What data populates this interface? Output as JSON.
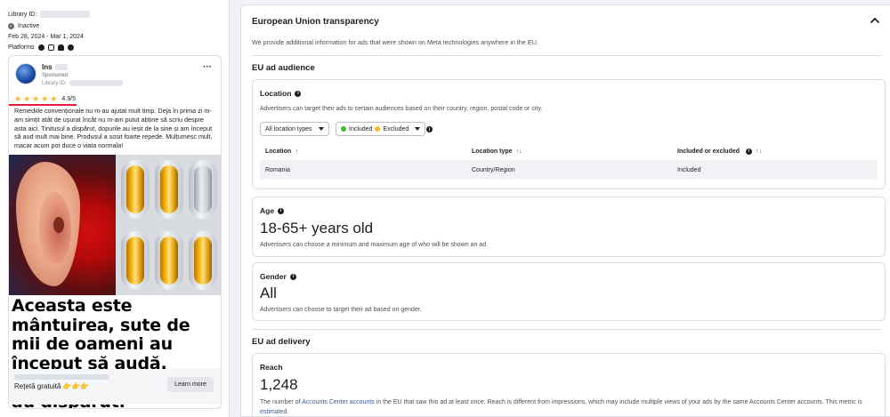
{
  "left": {
    "library_id_label": "Library ID:",
    "status": "Inactive",
    "date_range": "Feb 28, 2024 - Mar 1, 2024",
    "platforms_label": "Platforms",
    "platform_icons": [
      "facebook-icon",
      "instagram-icon",
      "audience-network-icon",
      "messenger-icon"
    ]
  },
  "ad": {
    "page_name": "Ins",
    "sponsored": "Sponsored",
    "library_id_label": "Library ID:",
    "rating": "4.9/5",
    "body": "Remediile convenționale nu m-au ajutat mult timp. Deja în prima zi m-am simțit atât de ușurat încât nu m-am putut abține să scriu despre asta aici. Tinitusul a dispărut, dopurile au ieșit de la sine și am început să aud mult mai bine. Produsul a sosit foarte repede. Mulțumesc mult, macar acum pot duce o viata normala!",
    "headline": "Aceasta este mântuirea, sute de mii de oameni au început să audă. Tinitusul și surditatea au dispărut.",
    "cta_title": "Rețetă gratuită",
    "cta_button": "Learn more"
  },
  "panel": {
    "title": "European Union transparency",
    "description": "We provide additional information for ads that were shown on Meta technologies anywhere in the EU.",
    "audience_title": "EU ad audience",
    "location": {
      "title": "Location",
      "description": "Advertisers can target their ads to certain audiences based on their country, region, postal code or city.",
      "filter_location_types": "All location types",
      "filter_included": "Included",
      "filter_excluded": "Excluded",
      "columns": [
        "Location",
        "Location type",
        "Included or excluded"
      ],
      "rows": [
        {
          "location": "Romania",
          "type": "Country/Region",
          "status": "Included"
        }
      ]
    },
    "age": {
      "title": "Age",
      "value": "18-65+ years old",
      "description": "Advertisers can choose a minimum and maximum age of who will be shown an ad."
    },
    "gender": {
      "title": "Gender",
      "value": "All",
      "description": "Advertisers can choose to target their ad based on gender."
    },
    "delivery_title": "EU ad delivery",
    "reach": {
      "title": "Reach",
      "value": "1,248",
      "desc_part1": "The number of",
      "desc_link1": "Accounts Center accounts",
      "desc_part2": "in the EU that saw this ad at least once. Reach is different from impressions, which may include multiple views of your ads by the same Accounts Center accounts. This metric is",
      "desc_link2": "estimated."
    }
  },
  "colors": {
    "accent": "#1877f2",
    "link": "#385898",
    "star": "#f7b928",
    "underline": "#e41e3f"
  }
}
